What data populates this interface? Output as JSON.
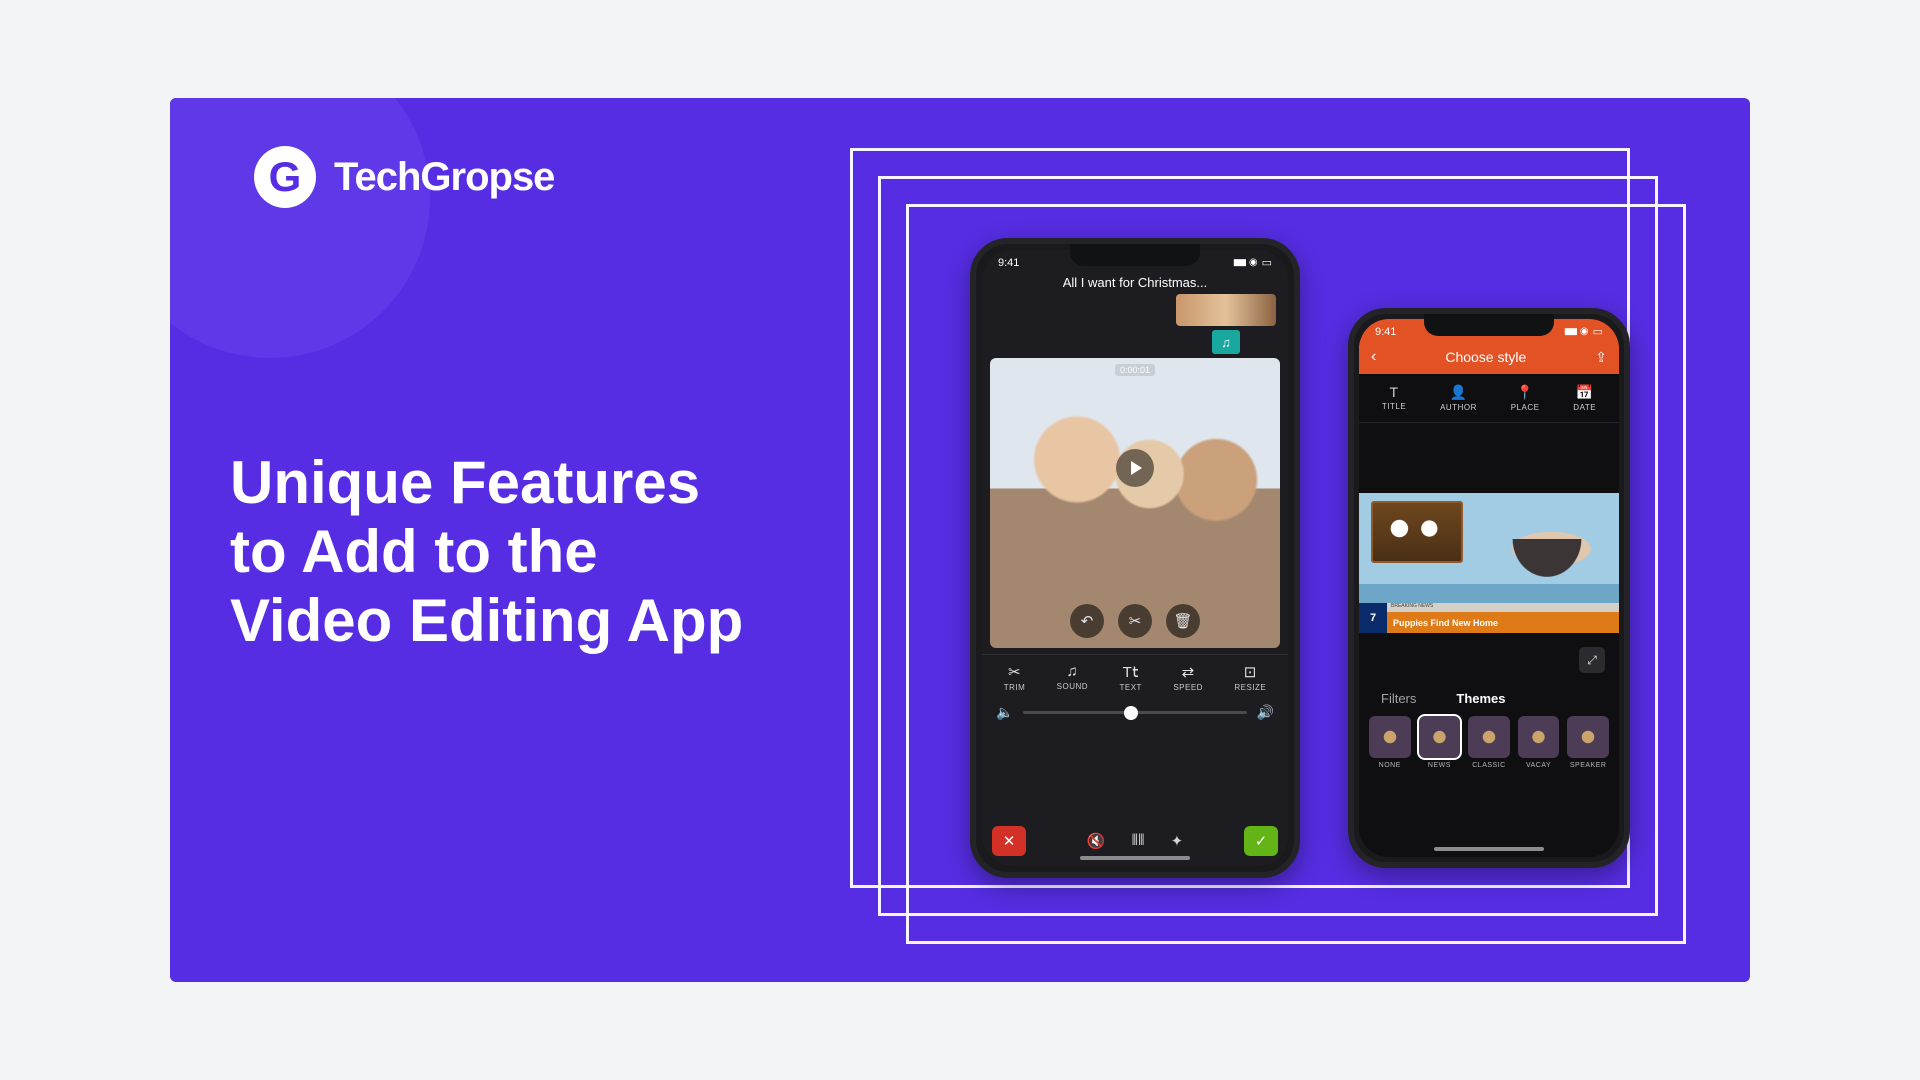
{
  "brand": "TechGropse",
  "headline": "Unique Features\nto Add to the\nVideo Editing App",
  "status_time": "9:41",
  "phone_left": {
    "title": "All I want for Christmas...",
    "timecode": "0:00:01",
    "float_tools": {
      "undo": "↶",
      "cut": "✂",
      "trash": "🗑"
    },
    "tools": [
      {
        "icon": "✂",
        "label": "TRIM"
      },
      {
        "icon": "♫",
        "label": "SOUND"
      },
      {
        "icon": "T𝗍",
        "label": "TEXT"
      },
      {
        "icon": "⇄",
        "label": "SPEED"
      },
      {
        "icon": "⊡",
        "label": "RESIZE"
      }
    ],
    "bottom": {
      "close": "✕",
      "confirm": "✓",
      "mute": "🔇",
      "wave": "⦀⦀",
      "fx": "✦"
    }
  },
  "phone_right": {
    "nav_title": "Choose style",
    "meta": [
      {
        "icon": "T",
        "label": "TITLE"
      },
      {
        "icon": "👤",
        "label": "AUTHOR"
      },
      {
        "icon": "📍",
        "label": "PLACE"
      },
      {
        "icon": "📅",
        "label": "DATE"
      }
    ],
    "lower_third": {
      "badge": "7",
      "tag": "BREAKING NEWS",
      "headline": "Puppies Find New Home"
    },
    "tab_filters": "Filters",
    "tab_themes": "Themes",
    "themes": [
      {
        "label": "NONE"
      },
      {
        "label": "NEWS",
        "active": true
      },
      {
        "label": "CLASSIC"
      },
      {
        "label": "VACAY"
      },
      {
        "label": "SPEAKER"
      }
    ]
  }
}
